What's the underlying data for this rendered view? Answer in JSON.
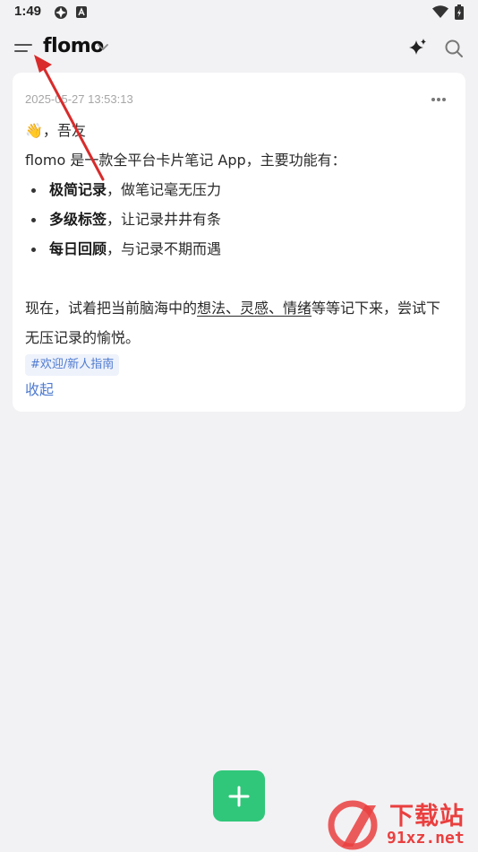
{
  "status_bar": {
    "time": "1:49"
  },
  "header": {
    "title": "flomo"
  },
  "memo": {
    "timestamp": "2025-05-27 13:53:13",
    "greeting": "👋，吾友",
    "intro": "flomo 是一款全平台卡片笔记 App，主要功能有：",
    "features": [
      {
        "title": "极简记录",
        "desc": "，做笔记毫无压力"
      },
      {
        "title": "多级标签",
        "desc": "，让记录井井有条"
      },
      {
        "title": "每日回顾",
        "desc": "，与记录不期而遇"
      }
    ],
    "para_before": "现在，试着把当前脑海中的",
    "para_underlined": "想法、灵感、情绪",
    "para_after": "等等记下来，尝试下无压记录的愉悦。",
    "tag": "#欢迎/新人指南",
    "collapse_label": "收起"
  },
  "fab": {
    "icon": "plus-icon"
  },
  "watermark": {
    "line1": "下载站",
    "line2": "91xz.net"
  },
  "colors": {
    "background": "#f2f2f4",
    "card": "#ffffff",
    "accent_green": "#30c77a",
    "link_blue": "#4f7bd0",
    "annotation_red": "#d92b2b"
  }
}
